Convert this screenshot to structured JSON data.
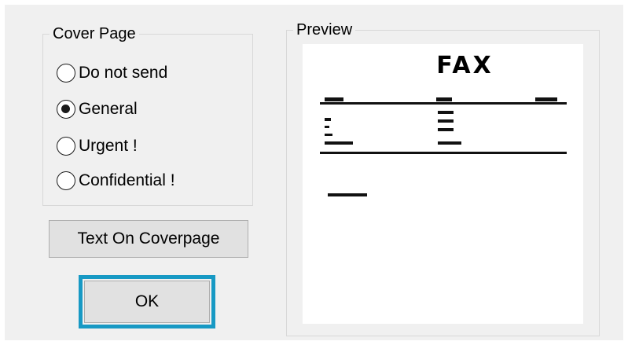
{
  "cover_page": {
    "title": "Cover Page",
    "options": [
      {
        "label": "Do not send",
        "checked": false
      },
      {
        "label": "General",
        "checked": true
      },
      {
        "label": "Urgent !",
        "checked": false
      },
      {
        "label": "Confidential !",
        "checked": false
      }
    ]
  },
  "buttons": {
    "text_on_coverpage": "Text On Coverpage",
    "ok": "OK"
  },
  "preview": {
    "title": "Preview",
    "fax_heading": "FAX"
  },
  "colors": {
    "dialog_background": "#f0f0f0",
    "focus_ring": "#1799c4",
    "button_face": "#e1e1e1"
  }
}
